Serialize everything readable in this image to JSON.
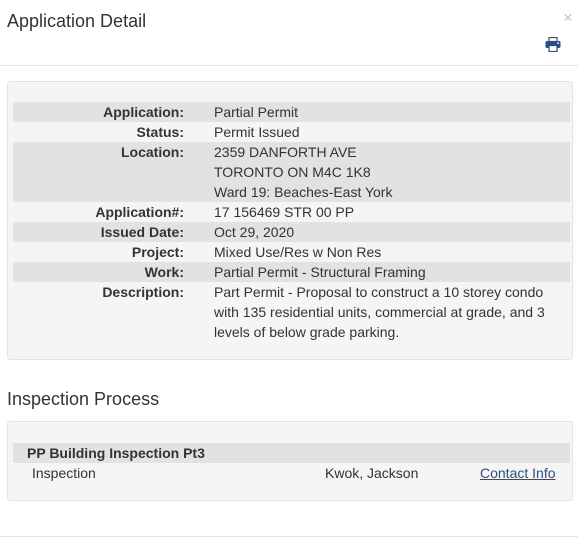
{
  "header": {
    "title": "Application Detail",
    "close_glyph": "×",
    "close_icon": "close-icon",
    "print_icon": "printer-icon"
  },
  "details": [
    {
      "label": "Application:",
      "values": [
        "Partial Permit"
      ]
    },
    {
      "label": "Status:",
      "values": [
        "Permit Issued"
      ]
    },
    {
      "label": "Location:",
      "values": [
        "2359 DANFORTH AVE",
        "TORONTO ON M4C 1K8",
        "Ward 19: Beaches-East York"
      ]
    },
    {
      "label": "Application#:",
      "values": [
        "17 156469 STR 00 PP"
      ]
    },
    {
      "label": "Issued Date:",
      "values": [
        "Oct 29, 2020"
      ]
    },
    {
      "label": "Project:",
      "values": [
        "Mixed Use/Res w Non Res"
      ]
    },
    {
      "label": "Work:",
      "values": [
        "Partial Permit - Structural Framing"
      ]
    },
    {
      "label": "Description:",
      "values": [
        "Part Permit - Proposal to construct a 10 storey condo",
        "with 135 residential units, commercial at grade, and 3",
        "levels of below grade parking."
      ]
    }
  ],
  "inspection": {
    "section_title": "Inspection Process",
    "group_title": "PP Building Inspection Pt3",
    "row": {
      "type": "Inspection",
      "inspector": "Kwok, Jackson",
      "link_label": "Contact Info"
    }
  },
  "colors": {
    "link": "#26508c",
    "row_shade": "#e2e2e2",
    "panel_bg": "#f5f5f5"
  }
}
